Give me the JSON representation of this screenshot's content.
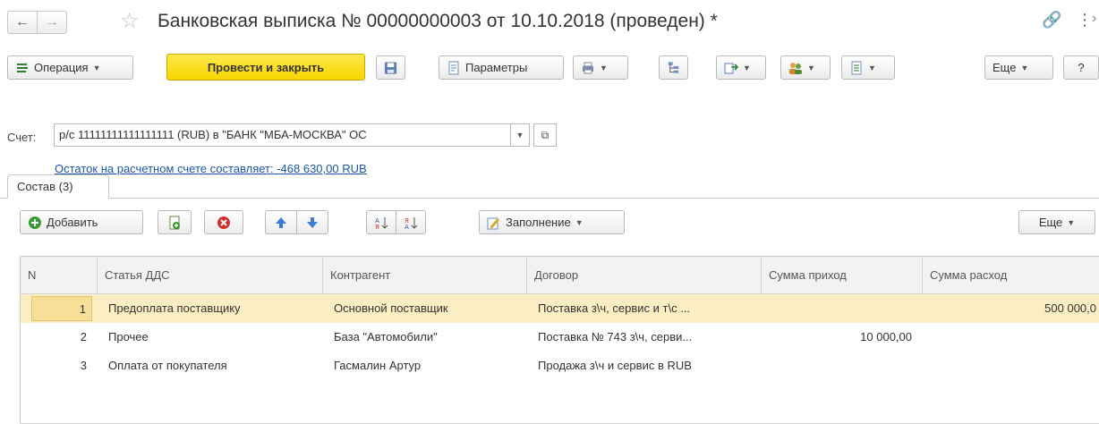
{
  "header": {
    "title": "Банковская выписка № 00000000003 от 10.10.2018 (проведен) *"
  },
  "toolbar": {
    "operation_label": "Операция",
    "post_close_label": "Провести и закрыть",
    "params_label": "Параметры",
    "more_label": "Еще",
    "help_label": "?"
  },
  "account": {
    "label": "Счет:",
    "value": "р/с 11111111111111111 (RUB) в \"БАНК \"МБА-МОСКВА\" ОС",
    "balance_link": "Остаток на расчетном счете составляет: -468 630,00 RUB"
  },
  "tabs": [
    {
      "label": "Состав (3)"
    }
  ],
  "table_toolbar": {
    "add_label": "Добавить",
    "fill_label": "Заполнение",
    "more_label": "Еще"
  },
  "table": {
    "columns": [
      "N",
      "Статья ДДС",
      "Контрагент",
      "Договор",
      "Сумма приход",
      "Сумма расход"
    ],
    "rows": [
      {
        "n": "1",
        "item": "Предоплата поставщику",
        "counterparty": "Основной поставщик",
        "contract": "Поставка з\\ч, сервис и т\\с ...",
        "income": "",
        "expense": "500 000,0"
      },
      {
        "n": "2",
        "item": "Прочее",
        "counterparty": "База \"Автомобили\"",
        "contract": "Поставка № 743 з\\ч, серви...",
        "income": "10 000,00",
        "expense": ""
      },
      {
        "n": "3",
        "item": "Оплата от покупателя",
        "counterparty": "Гасмалин Артур",
        "contract": "Продажа з\\ч и сервис в RUB",
        "income": "",
        "expense": ""
      }
    ]
  },
  "colors": {
    "accent_yellow": "#f6d500",
    "link_blue": "#1a57a8",
    "selected_row": "#fbeec2"
  }
}
